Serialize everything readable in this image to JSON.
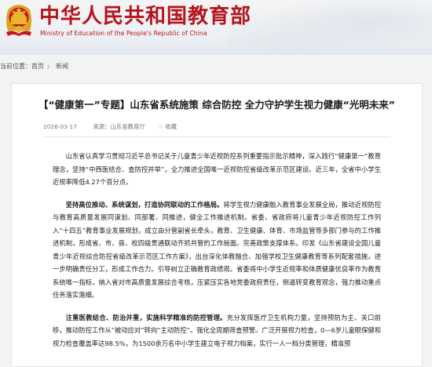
{
  "header": {
    "title": "中华人民共和国教育部",
    "subtitle": "Ministry of Education of the People's Republic of China"
  },
  "breadcrumb": {
    "prefix": "当前位置：",
    "home": "首页",
    "current": "新闻"
  },
  "article": {
    "title": "【“健康第一”专题】山东省系统施策 综合防控 全力守护学生视力健康“光明未来”",
    "date": "2026-03-17",
    "source": "来源：山东省教育厅",
    "favorite": "收藏",
    "paragraphs": [
      {
        "lead": "",
        "text": "山东省认真学习贯彻习近平总书记关于儿童青少年近视防控系列重要指示批示精神，深入践行“健康第一”教育理念，坚持“中西医结合、查防控并举”，全力推进全国唯一近视防控省级改革示范区建设。近三年，全省中小学生近视率降低4.27个百分点。"
      },
      {
        "lead": "坚持高位推动、系统谋划，打造协同联动的工作格局。",
        "text": "将学生视力健康融入教育事业发展全局，推动近视防控与教育高质量发展同谋划、同部署、同推进，健全工作推进机制。省委、省政府将儿童青少年近视防控工作列入“十四五”教育事业发展规划，成立由分管副省长牵头，教育、卫生健康、体育、市场监管等多部门参与的工作推进机制，形成省、市、县、校四级贯通联动齐抓共管的工作局面。完善政策支撑体系。印发《山东省建设全国儿童青少年近视综合防控省级改革示范区工作方案》，出台深化体教融合、加强学校卫生健康教育等系列配套措施，进一步明确责任分工，形成工作合力。引导树立正确教育政绩观。省委将中小学生近视率和体质健康优良率作为教育系统唯一指标，纳入省对市高质量发展综合考核，压紧压实各地党委政府责任，倒逼转变教育观念，强力推动重点任务落实落细。"
      },
      {
        "lead": "注重医教结合、防治并重，实施科学精准的防控管理。",
        "text": "充分发挥医疗卫生机构力量，坚持预防为主、关口前移，推动防控工作从“被动应对”转向“主动防控”。强化全周期筛查预警。广泛开展视力检查，0—6岁儿童眼保健和视力检查覆盖率达98.5%，为1500余万名中小学生建立电子视力档案，实行一人一档分类管理，精准预"
      }
    ]
  }
}
